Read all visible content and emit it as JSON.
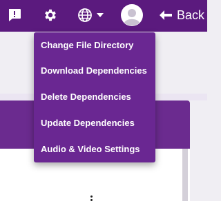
{
  "toolbar": {
    "feedback_icon": "feedback-icon",
    "settings_icon": "gear-icon",
    "language_icon": "globe-icon",
    "avatar_icon": "avatar-icon",
    "back_label": "Back"
  },
  "settings_menu": {
    "items": [
      {
        "label": "Change File Directory"
      },
      {
        "label": "Download Dependencies"
      },
      {
        "label": "Delete Dependencies"
      },
      {
        "label": "Update Dependencies"
      },
      {
        "label": "Audio & Video Settings"
      }
    ]
  },
  "colors": {
    "topbar": "#5b1a7e",
    "menu": "#6a2792",
    "header": "#6b2b8f"
  }
}
